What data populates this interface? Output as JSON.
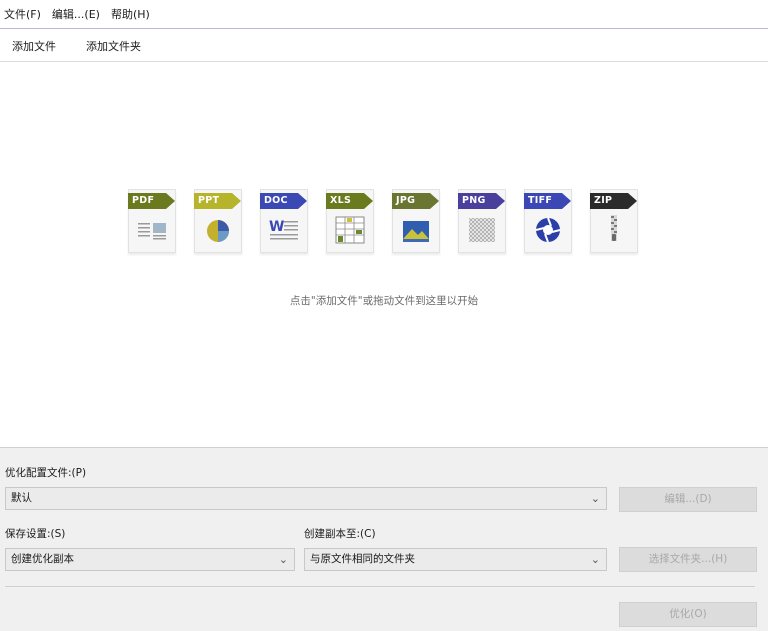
{
  "menubar": {
    "items": [
      {
        "label": "文件(F)"
      },
      {
        "label": "编辑...(E)"
      },
      {
        "label": "帮助(H)"
      }
    ]
  },
  "toolbar": {
    "add_file": "添加文件",
    "add_folder": "添加文件夹"
  },
  "file_types": [
    {
      "label": "PDF",
      "icon": "pdf-icon",
      "color": "#6b7a1f"
    },
    {
      "label": "PPT",
      "icon": "ppt-icon",
      "color": "#b5b42a"
    },
    {
      "label": "DOC",
      "icon": "doc-icon",
      "color": "#3a49b3"
    },
    {
      "label": "XLS",
      "icon": "xls-icon",
      "color": "#6a7a1e"
    },
    {
      "label": "JPG",
      "icon": "jpg-icon",
      "color": "#6b7532"
    },
    {
      "label": "PNG",
      "icon": "png-icon",
      "color": "#4b3f9c"
    },
    {
      "label": "TIFF",
      "icon": "tiff-icon",
      "color": "#3b47b4"
    },
    {
      "label": "ZIP",
      "icon": "zip-icon",
      "color": "#2b2b2b"
    }
  ],
  "hint": "点击\"添加文件\"或拖动文件到这里以开始",
  "settings": {
    "profile_label": "优化配置文件:(P)",
    "profile_value": "默认",
    "edit_button": "编辑...(D)",
    "save_label": "保存设置:(S)",
    "save_value": "创建优化副本",
    "copy_to_label": "创建副本至:(C)",
    "copy_to_value": "与原文件相同的文件夹",
    "choose_folder_button": "选择文件夹...(H)",
    "optimize_button": "优化(O)"
  }
}
